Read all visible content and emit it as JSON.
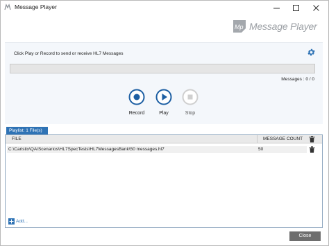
{
  "window": {
    "title": "Message Player",
    "logo_text": "Message Player",
    "logo_badge_text": "Mp"
  },
  "player": {
    "instruction": "Click Play or Record to send or receive HL7 Messages",
    "progress_value": 0,
    "messages_text": "Messages : 0 / 0",
    "controls": [
      {
        "label": "Record",
        "icon": "record-icon",
        "enabled": true
      },
      {
        "label": "Play",
        "icon": "play-icon",
        "enabled": true
      },
      {
        "label": "Stop",
        "icon": "stop-icon",
        "enabled": false
      }
    ]
  },
  "playlist": {
    "tab_label": "Playlist: 1 File(s)",
    "columns": [
      "FILE",
      "MESSAGE COUNT"
    ],
    "rows": [
      {
        "file": "C:\\Caristix\\QA\\Scenarios\\HL7SpecTests\\HL7MessagesBank\\50 messages.hl7",
        "count": "50"
      }
    ],
    "add_label": "Add..."
  },
  "footer": {
    "close_label": "Close"
  },
  "colors": {
    "accent": "#2f73b5",
    "panel_bg": "#f4f7fb",
    "close_button": "#6e6e6e"
  }
}
